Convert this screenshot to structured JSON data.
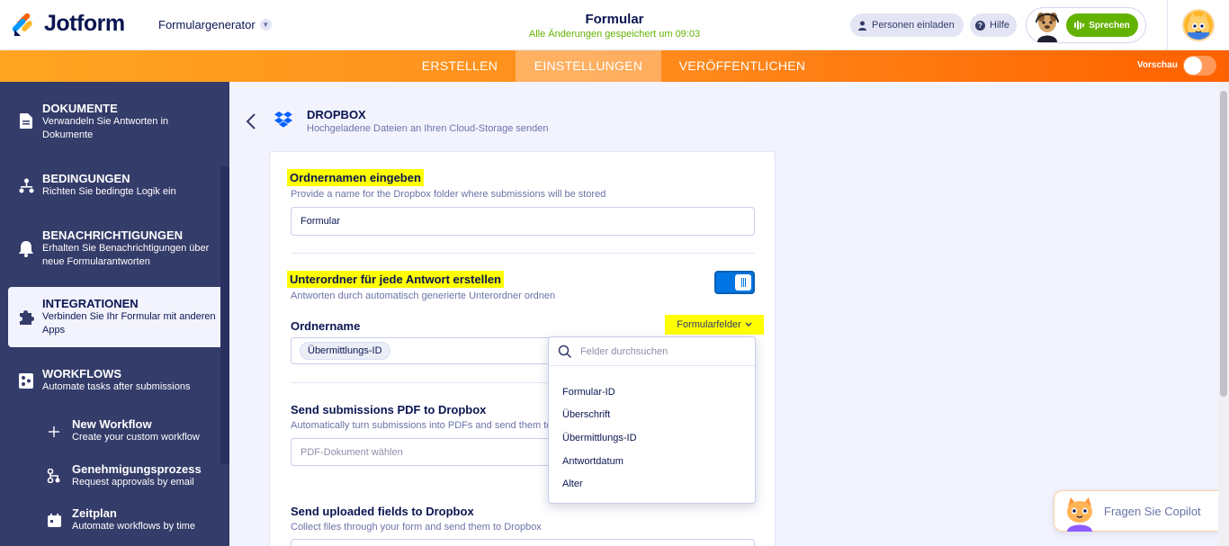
{
  "header": {
    "brand": "Jotform",
    "generator": "Formulargenerator",
    "form_title": "Formular",
    "saved_status": "Alle Änderungen gespeichert um 09:03",
    "invite_label": "Personen einladen",
    "help_label": "Hilfe",
    "speak_label": "Sprechen"
  },
  "nav": {
    "tabs": [
      {
        "label": "ERSTELLEN"
      },
      {
        "label": "EINSTELLUNGEN"
      },
      {
        "label": "VERÖFFENTLICHEN"
      }
    ],
    "preview_label": "Vorschau"
  },
  "sidebar": {
    "items": [
      {
        "title": "DOKUMENTE",
        "desc": "Verwandeln Sie Antworten in Dokumente"
      },
      {
        "title": "BEDINGUNGEN",
        "desc": "Richten Sie bedingte Logik ein"
      },
      {
        "title": "BENACHRICHTIGUNGEN",
        "desc": "Erhalten Sie Benachrichtigungen über neue Formularantworten"
      },
      {
        "title": "INTEGRATIONEN",
        "desc": "Verbinden Sie Ihr Formular mit anderen Apps"
      },
      {
        "title": "WORKFLOWS",
        "desc": "Automate tasks after submissions"
      }
    ],
    "subitems": [
      {
        "title": "New Workflow",
        "desc": "Create your custom workflow"
      },
      {
        "title": "Genehmigungsprozess",
        "desc": "Request approvals by email"
      },
      {
        "title": "Zeitplan",
        "desc": "Automate workflows by time"
      }
    ]
  },
  "main": {
    "section_title": "DROPBOX",
    "section_subtitle": "Hochgeladene Dateien an Ihren Cloud-Storage senden",
    "folder_name": {
      "label": "Ordnernamen eingeben",
      "hint": "Provide a name for the Dropbox folder where submissions will be stored",
      "value": "Formular"
    },
    "subfolder": {
      "label": "Unterordner für jede Antwort erstellen",
      "hint": "Antworten durch automatisch generierte Unterordner ordnen",
      "enabled": true,
      "field_label": "Ordnername",
      "form_fields_button": "Formularfelder",
      "chip": "Übermittlungs-ID"
    },
    "pdf": {
      "label": "Send submissions PDF to Dropbox",
      "hint": "Automatically turn submissions into PDFs and send them to",
      "placeholder": "PDF-Dokument wählen"
    },
    "uploads": {
      "label": "Send uploaded fields to Dropbox",
      "hint": "Collect files through your form and send them to Dropbox"
    }
  },
  "dropdown": {
    "search_placeholder": "Felder durchsuchen",
    "options": [
      "Formular-ID",
      "Überschrift",
      "Übermittlungs-ID",
      "Antwortdatum",
      "Alter"
    ]
  },
  "copilot": {
    "label": "Fragen Sie Copilot"
  },
  "colors": {
    "navy": "#0a1551",
    "sidebar": "#343c6a",
    "orange_start": "#ffa521",
    "orange_end": "#ff6100",
    "green": "#64b200",
    "blue": "#0075e3",
    "highlight": "#ffff00"
  }
}
